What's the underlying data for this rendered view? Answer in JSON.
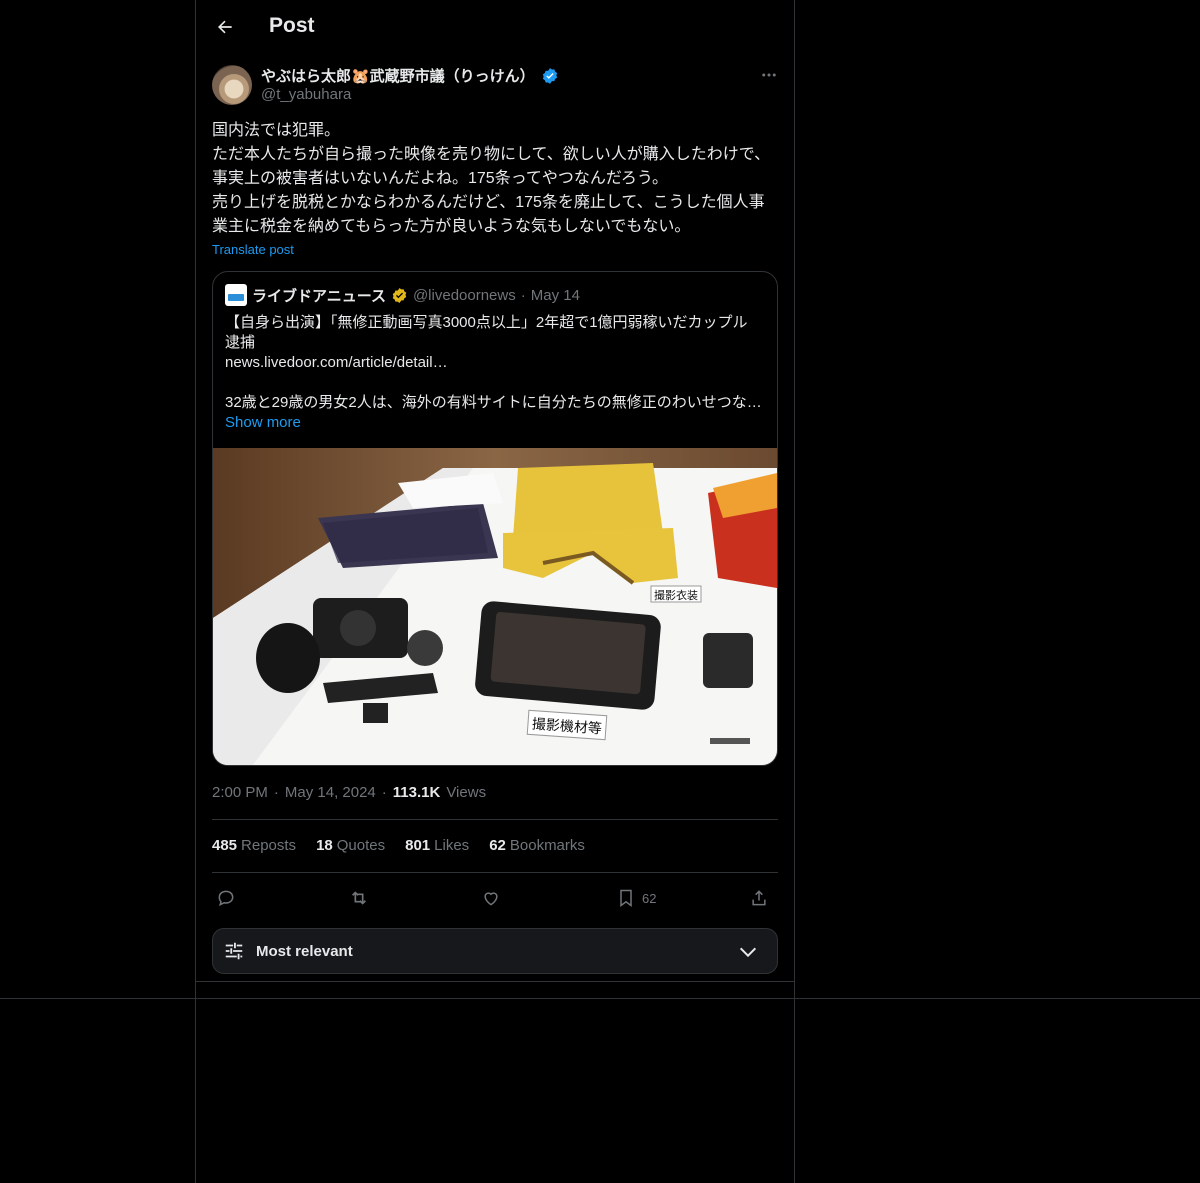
{
  "header": {
    "title": "Post"
  },
  "author": {
    "display_name": "やぶはら太郎🐹武蔵野市議（りっけん）",
    "handle": "@t_yabuhara"
  },
  "post": {
    "text": "国内法では犯罪。\nただ本人たちが自ら撮った映像を売り物にして、欲しい人が購入したわけで、事実上の被害者はいないんだよね。175条ってやつなんだろう。\n売り上げを脱税とかならわかるんだけど、175条を廃止して、こうした個人事業主に税金を納めてもらった方が良いような気もしないでもない。",
    "translate_label": "Translate post"
  },
  "quote": {
    "name": "ライブドアニュース",
    "handle": "@livedoornews",
    "date": "May 14",
    "line1": "【自身ら出演】「無修正動画写真3000点以上」2年超で1億円弱稼いだカップル",
    "line2": "逮捕",
    "line3": "news.livedoor.com/article/detail…",
    "line4": "32歳と29歳の男女2人は、海外の有料サイトに自分たちの無修正のわいせつな…",
    "show_more": "Show more",
    "image_label_1": "撮影衣装",
    "image_label_2": "撮影機材等"
  },
  "meta": {
    "time": "2:00 PM",
    "date": "May 14, 2024",
    "views_count": "113.1K",
    "views_label": "Views",
    "sep": "·"
  },
  "stats": {
    "reposts_count": "485",
    "reposts_label": "Reposts",
    "quotes_count": "18",
    "quotes_label": "Quotes",
    "likes_count": "801",
    "likes_label": "Likes",
    "bookmarks_count": "62",
    "bookmarks_label": "Bookmarks"
  },
  "actions": {
    "bookmark_count": "62"
  },
  "sort": {
    "label": "Most relevant"
  },
  "colors": {
    "accent": "#1d9bf0",
    "verified_gold": "#e2b719",
    "border": "#2f3336",
    "muted": "#71767b"
  }
}
